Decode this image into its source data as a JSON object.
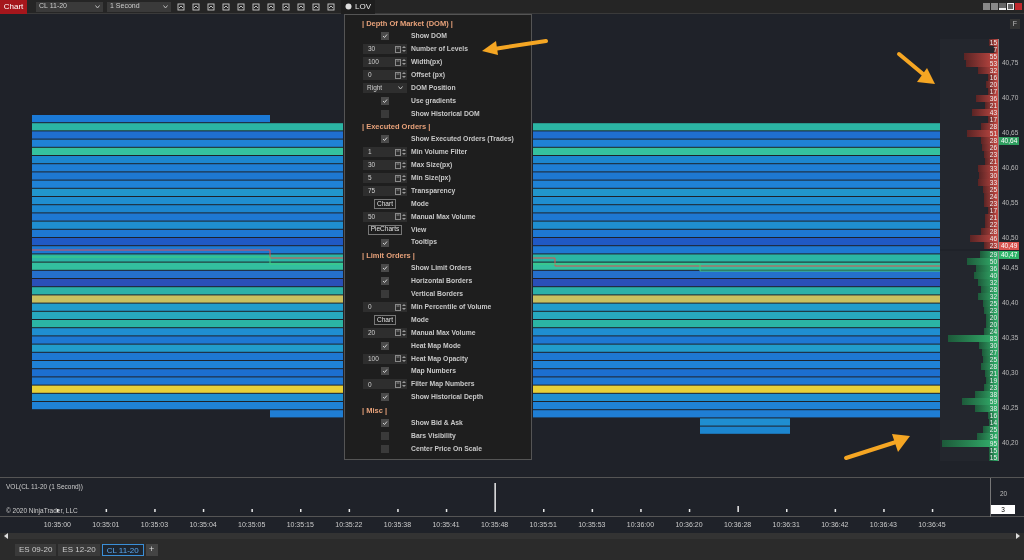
{
  "toolbar": {
    "chart_button": "Chart",
    "instrument": "CL 11-20",
    "interval": "1 Second",
    "indicator_button": "LOV"
  },
  "indicator_menu": {
    "sections": [
      {
        "title": "| Depth Of Market (DOM) |",
        "items": [
          {
            "kind": "checkbox",
            "label": "Show DOM",
            "checked": true
          },
          {
            "kind": "spinner",
            "label": "Number of Levels",
            "value": "30"
          },
          {
            "kind": "spinner",
            "label": "Width(px)",
            "value": "100"
          },
          {
            "kind": "spinner",
            "label": "Offset (px)",
            "value": "0"
          },
          {
            "kind": "select",
            "label": "DOM Position",
            "value": "Right"
          },
          {
            "kind": "checkbox",
            "label": "Use gradients",
            "checked": true
          },
          {
            "kind": "checkbox",
            "label": "Show Historical DOM",
            "checked": false
          }
        ]
      },
      {
        "title": "| Executed Orders |",
        "items": [
          {
            "kind": "checkbox",
            "label": "Show Executed Orders (Trades)",
            "checked": true
          },
          {
            "kind": "spinner",
            "label": "Min Volume Filter",
            "value": "1"
          },
          {
            "kind": "spinner",
            "label": "Max Size(px)",
            "value": "30"
          },
          {
            "kind": "spinner",
            "label": "Min Size(px)",
            "value": "5"
          },
          {
            "kind": "spinner",
            "label": "Transparency",
            "value": "75"
          },
          {
            "kind": "button",
            "label": "Mode",
            "value": "Chart"
          },
          {
            "kind": "spinner",
            "label": "Manual Max Volume",
            "value": "50"
          },
          {
            "kind": "button",
            "label": "View",
            "value": "PieCharts"
          },
          {
            "kind": "checkbox",
            "label": "Tooltips",
            "checked": true
          }
        ]
      },
      {
        "title": "| Limit Orders |",
        "items": [
          {
            "kind": "checkbox",
            "label": "Show Limit Orders",
            "checked": true
          },
          {
            "kind": "checkbox",
            "label": "Horizontal Borders",
            "checked": true
          },
          {
            "kind": "checkbox",
            "label": "Vertical Borders",
            "checked": false
          },
          {
            "kind": "spinner",
            "label": "Min Percentile of Volume",
            "value": "0"
          },
          {
            "kind": "button",
            "label": "Mode",
            "value": "Chart"
          },
          {
            "kind": "spinner",
            "label": "Manual Max Volume",
            "value": "20"
          },
          {
            "kind": "checkbox",
            "label": "Heat Map Mode",
            "checked": true
          },
          {
            "kind": "spinner",
            "label": "Heat Map Opacity",
            "value": "100"
          },
          {
            "kind": "checkbox",
            "label": "Map Numbers",
            "checked": true
          },
          {
            "kind": "spinner",
            "label": "Filter Map Numbers",
            "value": "0"
          },
          {
            "kind": "checkbox",
            "label": "Show Historical Depth",
            "checked": true
          }
        ]
      },
      {
        "title": "| Misc |",
        "items": [
          {
            "kind": "checkbox",
            "label": "Show Bid & Ask",
            "checked": true
          },
          {
            "kind": "checkbox",
            "label": "Bars Visibility",
            "checked": false
          },
          {
            "kind": "checkbox",
            "label": "Center Price On Scale",
            "checked": false
          }
        ]
      }
    ]
  },
  "scale_button": "F",
  "dom_ladder": {
    "asks": [
      {
        "size": "15",
        "level": 0.16
      },
      {
        "size": "7",
        "level": 0.07
      },
      {
        "size": "55",
        "level": 0.58
      },
      {
        "size": "53",
        "level": 0.56,
        "tick": "40,75"
      },
      {
        "size": "32",
        "level": 0.34
      },
      {
        "size": "16",
        "level": 0.17
      },
      {
        "size": "20",
        "level": 0.21
      },
      {
        "size": "17",
        "level": 0.18
      },
      {
        "size": "36",
        "level": 0.38,
        "tick": "40,70"
      },
      {
        "size": "21",
        "level": 0.22
      },
      {
        "size": "43",
        "level": 0.45
      },
      {
        "size": "17",
        "level": 0.18
      },
      {
        "size": "28",
        "level": 0.29
      },
      {
        "size": "51",
        "level": 0.54,
        "tick": "40,65"
      },
      {
        "size": "28",
        "level": 0.29,
        "marker": {
          "text": "40,64",
          "color": "#2f9e5f"
        }
      },
      {
        "size": "26",
        "level": 0.27
      },
      {
        "size": "23",
        "level": 0.24
      },
      {
        "size": "21",
        "level": 0.22
      },
      {
        "size": "33",
        "level": 0.35,
        "tick": "40,60"
      },
      {
        "size": "30",
        "level": 0.32
      },
      {
        "size": "33",
        "level": 0.35
      },
      {
        "size": "25",
        "level": 0.26
      },
      {
        "size": "24",
        "level": 0.25
      },
      {
        "size": "23",
        "level": 0.24,
        "tick": "40,55"
      },
      {
        "size": "17",
        "level": 0.18
      },
      {
        "size": "21",
        "level": 0.22
      },
      {
        "size": "22",
        "level": 0.23
      },
      {
        "size": "28",
        "level": 0.29
      },
      {
        "size": "46",
        "level": 0.48,
        "tick": "40,50"
      },
      {
        "size": "23",
        "level": 0.24,
        "marker": {
          "text": "40,49",
          "color": "#d9534f"
        }
      }
    ],
    "bids": [
      {
        "size": "29",
        "level": 0.31,
        "marker": {
          "text": "40,47",
          "color": "#2fb36a"
        }
      },
      {
        "size": "50",
        "level": 0.53
      },
      {
        "size": "36",
        "level": 0.38,
        "tick": "40,45"
      },
      {
        "size": "40",
        "level": 0.42
      },
      {
        "size": "32",
        "level": 0.34
      },
      {
        "size": "28",
        "level": 0.29
      },
      {
        "size": "32",
        "level": 0.34
      },
      {
        "size": "25",
        "level": 0.26,
        "tick": "40,40"
      },
      {
        "size": "23",
        "level": 0.24
      },
      {
        "size": "20",
        "level": 0.21
      },
      {
        "size": "20",
        "level": 0.21
      },
      {
        "size": "24",
        "level": 0.25
      },
      {
        "size": "83",
        "level": 0.87,
        "tick": "40,35"
      },
      {
        "size": "30",
        "level": 0.32
      },
      {
        "size": "27",
        "level": 0.28
      },
      {
        "size": "25",
        "level": 0.26
      },
      {
        "size": "28",
        "level": 0.29
      },
      {
        "size": "21",
        "level": 0.22,
        "tick": "40,30"
      },
      {
        "size": "19",
        "level": 0.2
      },
      {
        "size": "23",
        "level": 0.24
      },
      {
        "size": "38",
        "level": 0.4
      },
      {
        "size": "59",
        "level": 0.62
      },
      {
        "size": "38",
        "level": 0.4,
        "tick": "40,25"
      },
      {
        "size": "16",
        "level": 0.17
      },
      {
        "size": "14",
        "level": 0.15
      },
      {
        "size": "25",
        "level": 0.26
      },
      {
        "size": "34",
        "level": 0.36
      },
      {
        "size": "95",
        "level": 0.96,
        "tick": "40,20"
      },
      {
        "size": "15",
        "level": 0.16
      },
      {
        "size": "15",
        "level": 0.16
      }
    ]
  },
  "volume_panel": {
    "title": "VOL(CL 11-20 (1 Second))",
    "copyright": "© 2020 NinjaTrader, LLC",
    "axis_label": "20",
    "marker": "3"
  },
  "time_axis": [
    "10:35:00",
    "10:35:01",
    "10:35:03",
    "10:35:04",
    "10:35:05",
    "10:35:15",
    "10:35:22",
    "10:35:38",
    "10:35:41",
    "10:35:48",
    "10:35:51",
    "10:35:53",
    "10:36:00",
    "10:36:20",
    "10:36:28",
    "10:36:31",
    "10:36:42",
    "10:36:43",
    "10:36:45"
  ],
  "chart_tabs": [
    {
      "label": "ES 09-20",
      "selected": false
    },
    {
      "label": "ES 12-20",
      "selected": false
    },
    {
      "label": "CL 11-20",
      "selected": true
    }
  ],
  "add_tab_button": "+"
}
